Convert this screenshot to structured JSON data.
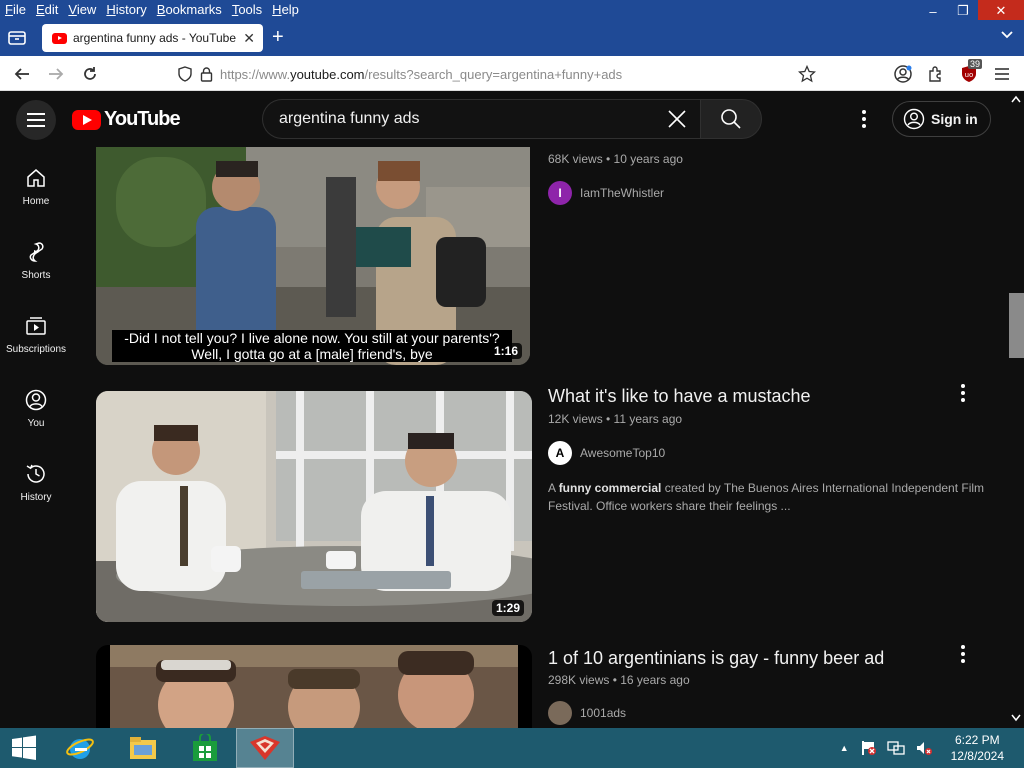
{
  "browser": {
    "menu": [
      "File",
      "Edit",
      "View",
      "History",
      "Bookmarks",
      "Tools",
      "Help"
    ],
    "tab_title": "argentina funny ads - YouTube",
    "url_prefix": "https://www.",
    "url_host": "youtube.com",
    "url_path": "/results?search_query=argentina+funny+ads",
    "extension_badge": "39"
  },
  "youtube": {
    "logo_text": "YouTube",
    "search_value": "argentina funny ads",
    "signin_label": "Sign in",
    "guide": [
      {
        "label": "Home"
      },
      {
        "label": "Shorts"
      },
      {
        "label": "Subscriptions"
      },
      {
        "label": "You"
      },
      {
        "label": "History"
      }
    ],
    "results": [
      {
        "meta": "68K views • 10 years ago",
        "channel": "IamTheWhistler",
        "channel_initial": "I",
        "duration": "1:16",
        "subtitle_1": "-Did I not tell you? I live alone now. You still at your parents'?",
        "subtitle_2": "Well, I gotta go at a [male] friend's, bye"
      },
      {
        "title": "What it's like to have a mustache",
        "meta": "12K views • 11 years ago",
        "channel": "AwesomeTop10",
        "channel_initial": "A",
        "duration": "1:29",
        "desc_prefix": "A ",
        "desc_bold": "funny commercial",
        "desc_rest": " created by The Buenos Aires International Independent Film Festival. Office workers share their feelings ..."
      },
      {
        "title": "1 of 10 argentinians is gay - funny beer ad",
        "meta": "298K views • 16 years ago",
        "channel": "1001ads"
      }
    ]
  },
  "taskbar": {
    "time": "6:22 PM",
    "date": "12/8/2024"
  },
  "colors": {
    "browser_chrome": "#1f4a96",
    "yt_background": "#0f0f0f",
    "yt_red": "#ff0000",
    "taskbar": "#1e5a6e"
  }
}
